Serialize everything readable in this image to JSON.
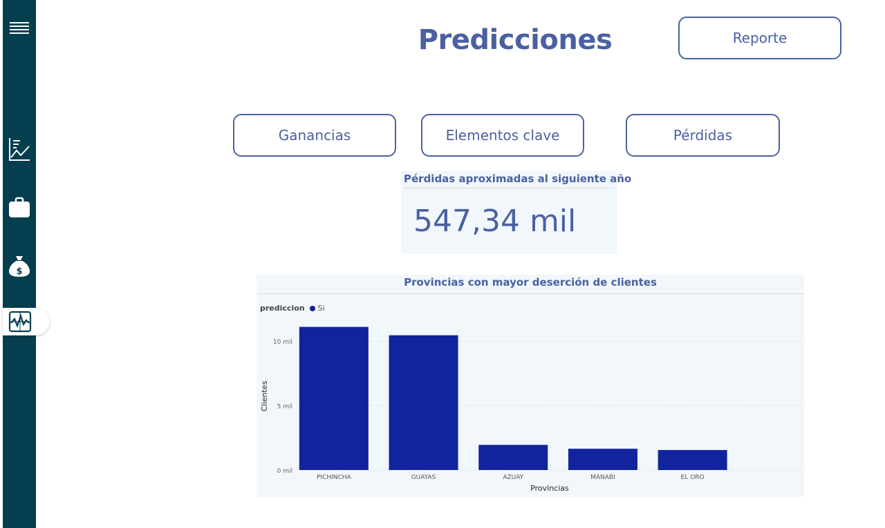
{
  "header": {
    "title": "Predicciones",
    "report_button": "Reporte"
  },
  "nav": {
    "buttons": [
      "Ganancias",
      "Elementos clave",
      "Pérdidas"
    ]
  },
  "sidebar": {
    "icons": [
      "hamburger-menu-icon",
      "line-chart-icon",
      "briefcase-icon",
      "money-bag-icon",
      "activity-chart-icon"
    ],
    "active": "activity-chart-icon"
  },
  "kpi": {
    "title": "Pérdidas aproximadas al siguiente año",
    "value": "547,34 mil"
  },
  "colors": {
    "sidebar": "#053e4e",
    "accent": "#4a60a1",
    "bar": "#12239e",
    "card_bg": "#f2f7fc"
  },
  "chart_data": {
    "type": "bar",
    "title": "Provincias con mayor deserción de clientes",
    "legend_title": "prediccion",
    "legend_position": "top-left",
    "series": [
      {
        "name": "Si",
        "values": [
          11100,
          10450,
          1950,
          1650,
          1550
        ]
      }
    ],
    "categories": [
      "PICHINCHA",
      "GUAYAS",
      "AZUAY",
      "MANABI",
      "EL ORO"
    ],
    "xlabel": "Provincias",
    "ylabel": "Clientes",
    "ylim": [
      0,
      11400
    ],
    "yticks": [
      {
        "value": 0,
        "label": "0 mil"
      },
      {
        "value": 5000,
        "label": "5 mil"
      },
      {
        "value": 10000,
        "label": "10 mil"
      }
    ],
    "grid": true
  }
}
